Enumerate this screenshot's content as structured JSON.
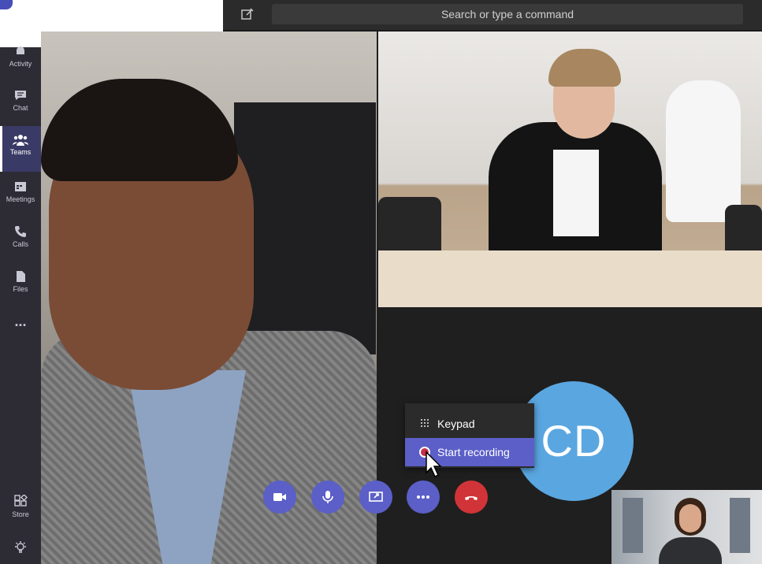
{
  "search": {
    "placeholder": "Search or type a command"
  },
  "sidebar": {
    "items": [
      {
        "label": "Activity",
        "icon": "bell-icon"
      },
      {
        "label": "Chat",
        "icon": "chat-icon"
      },
      {
        "label": "Teams",
        "icon": "teams-icon",
        "active": true
      },
      {
        "label": "Meetings",
        "icon": "calendar-icon"
      },
      {
        "label": "Calls",
        "icon": "phone-icon"
      },
      {
        "label": "Files",
        "icon": "file-icon"
      },
      {
        "label": "...",
        "icon": "more-icon"
      },
      {
        "label": "Store",
        "icon": "store-icon"
      },
      {
        "label": "Feedback",
        "icon": "lightbulb-icon"
      }
    ]
  },
  "call": {
    "avatar_initials": "CD",
    "menu": [
      {
        "label": "Keypad",
        "icon": "keypad-icon"
      },
      {
        "label": "Start recording",
        "icon": "record-icon"
      }
    ],
    "controls": [
      {
        "name": "camera",
        "icon": "video-camera-icon"
      },
      {
        "name": "mic",
        "icon": "microphone-icon"
      },
      {
        "name": "share",
        "icon": "share-screen-icon"
      },
      {
        "name": "more",
        "icon": "more-icon"
      },
      {
        "name": "hangup",
        "icon": "hangup-icon"
      }
    ]
  },
  "colors": {
    "accent": "#5b5fc7",
    "hangup": "#d13438",
    "avatar": "#5aa6e0",
    "sidebar": "#2d2c34"
  }
}
